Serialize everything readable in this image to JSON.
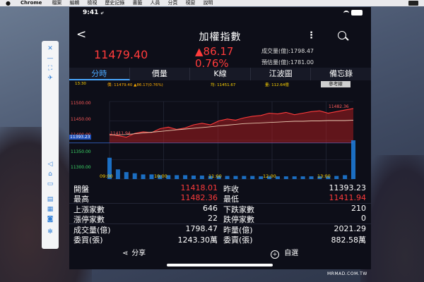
{
  "menubar": {
    "apple": "",
    "app": "Chrome",
    "items": [
      "檔案",
      "編輯",
      "檢視",
      "歷史記錄",
      "書籤",
      "人員",
      "分頁",
      "視窗",
      "說明"
    ]
  },
  "toolbar_icons": [
    "close-icon",
    "minus-icon",
    "expand-icon",
    "pin-icon",
    "volume-icon",
    "home-icon",
    "screenshot-icon",
    "rotate-icon",
    "keyboard-icon",
    "camera-icon",
    "settings-icon"
  ],
  "status": {
    "time": "9:41",
    "arrow": "⤶"
  },
  "nav": {
    "back": "<",
    "title": "加權指數",
    "more": "⋮"
  },
  "quote": {
    "price": "11479.40",
    "change": "▲86.17",
    "percent": "0.76%",
    "volume": "成交量(億):1798.47",
    "estimate": "預估量(億):1781.00"
  },
  "tabs": [
    "分時",
    "價量",
    "K線",
    "江波圖",
    "備忘錄"
  ],
  "chart_info": {
    "time": "13:30",
    "price": "價: 11479.40 ▲86.17(0.76%)",
    "avg": "均: 11451.67",
    "vol": "量: 112.64億",
    "ref": "參考線"
  },
  "chart_data": {
    "type": "line",
    "x_labels": [
      "09:00",
      "10:00",
      "11:00",
      "12:00",
      "13:00"
    ],
    "y_labels": [
      "11500.00",
      "11450.00",
      "11400.00",
      "11350.00",
      "11300.00"
    ],
    "ref_value": "11393.23",
    "high_label": "11482.36",
    "low_label": "11411.94",
    "ylim": [
      11300,
      11500
    ],
    "prev_close": 11393.23,
    "price": [
      11416,
      11412,
      11408,
      11418,
      11422,
      11420,
      11430,
      11434,
      11428,
      11432,
      11440,
      11444,
      11440,
      11450,
      11455,
      11452,
      11458,
      11462,
      11464,
      11470,
      11468,
      11472,
      11466,
      11470,
      11474,
      11476,
      11470,
      11474,
      11478,
      11482
    ],
    "avg": [
      11414,
      11414,
      11415,
      11417,
      11419,
      11421,
      11423,
      11425,
      11427,
      11429,
      11431,
      11433,
      11435,
      11437,
      11439,
      11441,
      11443,
      11444,
      11445,
      11446,
      11447,
      11448,
      11449,
      11449,
      11450,
      11450,
      11451,
      11451,
      11451,
      11452
    ],
    "volume": [
      0.55,
      0.25,
      0.18,
      0.15,
      0.12,
      0.12,
      0.1,
      0.1,
      0.1,
      0.1,
      0.09,
      0.09,
      0.08,
      0.08,
      0.08,
      0.08,
      0.08,
      0.08,
      0.07,
      0.07,
      0.07,
      0.07,
      0.07,
      0.07,
      0.07,
      0.07,
      0.07,
      0.08,
      0.1,
      1.0
    ]
  },
  "stats": [
    {
      "l1": "開盤",
      "v1": "11418.01",
      "l2": "昨收",
      "v2": "11393.23",
      "c1": "red",
      "c2": "white"
    },
    {
      "l1": "最高",
      "v1": "11482.36",
      "l2": "最低",
      "v2": "11411.94",
      "c1": "red",
      "c2": "red"
    },
    {
      "l1": "上漲家數",
      "v1": "646",
      "l2": "下跌家數",
      "v2": "210",
      "c1": "white",
      "c2": "white"
    },
    {
      "l1": "漲停家數",
      "v1": "22",
      "l2": "跌停家數",
      "v2": "0",
      "c1": "white",
      "c2": "white"
    },
    {
      "l1": "成交量(億)",
      "v1": "1798.47",
      "l2": "昨量(億)",
      "v2": "2021.29",
      "c1": "white",
      "c2": "white"
    },
    {
      "l1": "委買(張)",
      "v1": "1243.30萬",
      "l2": "委賣(張)",
      "v2": "882.58萬",
      "c1": "white",
      "c2": "white"
    }
  ],
  "bottom": {
    "share": "分享",
    "add": "自選"
  },
  "watermark": "MRMAD.COM.TW",
  "colors": {
    "up": "#ff3b3b",
    "accent": "#4aa8ff",
    "avg": "#e8c8b0",
    "volume": "#1e7fe0",
    "grid": "#2c2f40"
  }
}
